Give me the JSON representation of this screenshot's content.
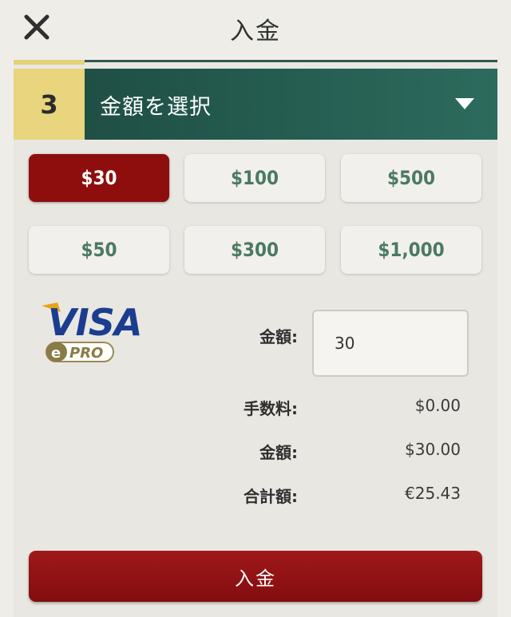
{
  "header": {
    "title": "入金",
    "close_icon": "close-icon"
  },
  "step": {
    "number": "3",
    "label": "金額を選択",
    "dropdown_icon": "chevron-down-icon"
  },
  "amounts": [
    {
      "label": "$30",
      "selected": true
    },
    {
      "label": "$100",
      "selected": false
    },
    {
      "label": "$500",
      "selected": false
    },
    {
      "label": "$50",
      "selected": false
    },
    {
      "label": "$300",
      "selected": false
    },
    {
      "label": "$1,000",
      "selected": false
    }
  ],
  "payment": {
    "logo_text": "VISA",
    "badge_text": "PRO"
  },
  "form": {
    "amount_label": "金額:",
    "amount_value": "30"
  },
  "summary": {
    "fee_label": "手数料:",
    "fee_value": "$0.00",
    "amount_label": "金額:",
    "amount_value": "$30.00",
    "total_label": "合計額:",
    "total_value": "€25.43"
  },
  "deposit_button": "入金",
  "colors": {
    "accent_red": "#8e0e0e",
    "header_green": "#2c6b5d",
    "step_yellow": "#e8d57e",
    "amount_text_green": "#4a7a62"
  }
}
